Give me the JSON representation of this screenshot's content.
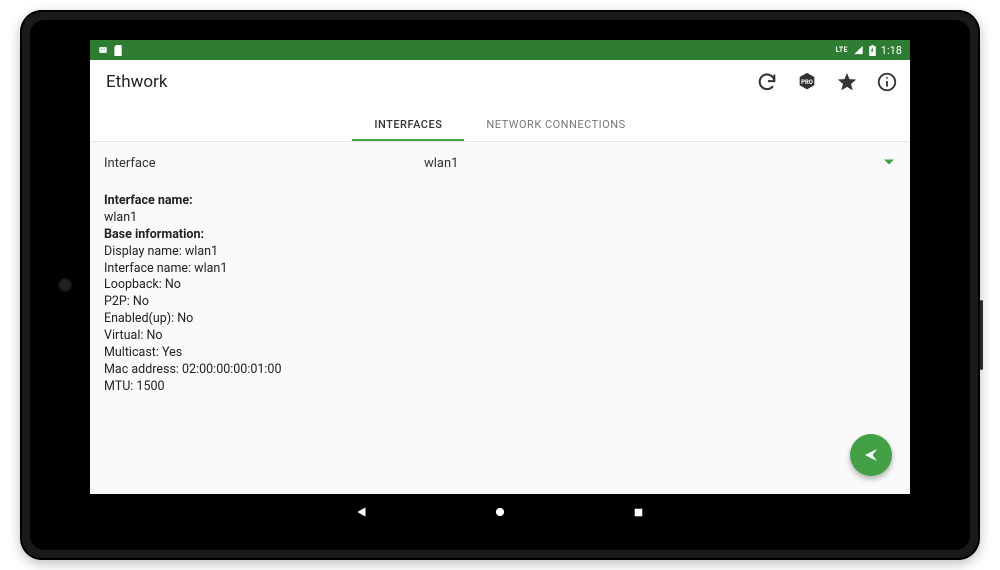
{
  "statusbar": {
    "network_label": "LTE",
    "time": "1:18"
  },
  "appbar": {
    "title": "Ethwork"
  },
  "tabs": [
    {
      "label": "INTERFACES",
      "active": true
    },
    {
      "label": "NETWORK CONNECTIONS",
      "active": false
    }
  ],
  "selector": {
    "label": "Interface",
    "value": "wlan1"
  },
  "details": {
    "section1_title": "Interface name:",
    "interface_name": "wlan1",
    "section2_title": "Base information:",
    "display_name": "Display name: wlan1",
    "iface_name": "Interface name: wlan1",
    "loopback": "Loopback: No",
    "p2p": "P2P: No",
    "enabled": "Enabled(up): No",
    "virtual": "Virtual: No",
    "multicast": "Multicast: Yes",
    "mac": "Mac address: 02:00:00:00:01:00",
    "mtu": "MTU: 1500"
  }
}
